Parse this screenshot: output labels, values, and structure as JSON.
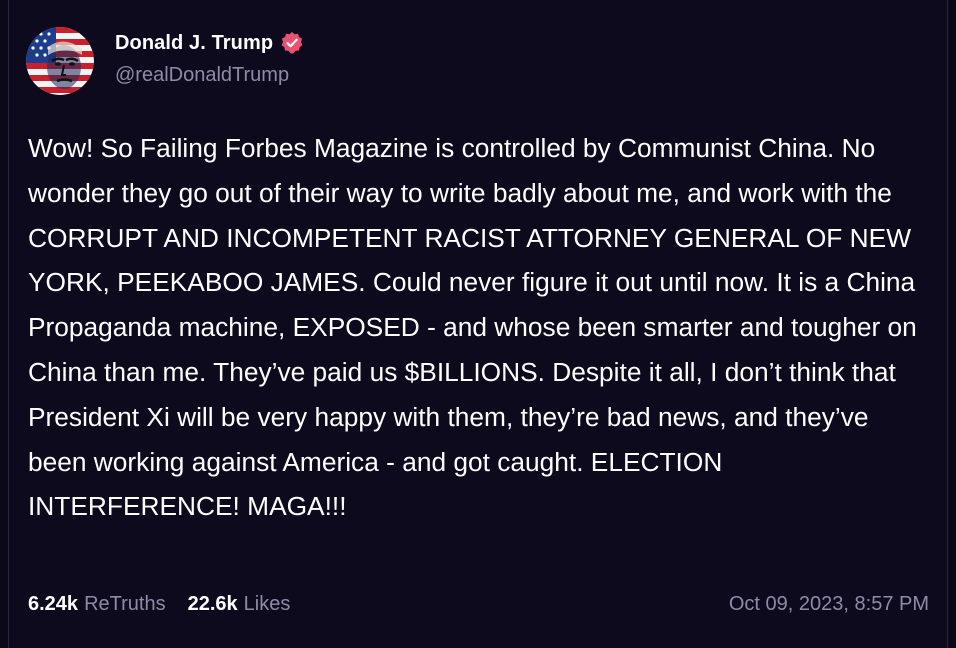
{
  "post": {
    "author": {
      "display_name": "Donald J. Trump",
      "handle": "@realDonaldTrump",
      "verified_icon": "verified-badge-icon",
      "avatar_icon": "avatar-image"
    },
    "text": "Wow! So Failing Forbes Magazine is controlled by Communist China. No wonder they go out of their way to write badly about me, and work with the CORRUPT AND INCOMPETENT RACIST ATTORNEY GENERAL OF NEW YORK, PEEKABOO JAMES. Could never figure it out until now. It is a China Propaganda machine, EXPOSED - and whose been smarter and tougher on China than me. They’ve paid us $BILLIONS. Despite it all, I don’t think that President Xi will be very happy with them, they’re bad news, and they’ve been working against America - and got caught. ELECTION INTERFERENCE! MAGA!!!",
    "stats": {
      "retruths_count": "6.24k",
      "retruths_label": "ReTruths",
      "likes_count": "22.6k",
      "likes_label": "Likes"
    },
    "timestamp": "Oct 09, 2023, 8:57 PM"
  },
  "colors": {
    "background": "#0d0a1e",
    "muted_text": "#8f8aa8",
    "verified_badge": "#e8516f"
  }
}
